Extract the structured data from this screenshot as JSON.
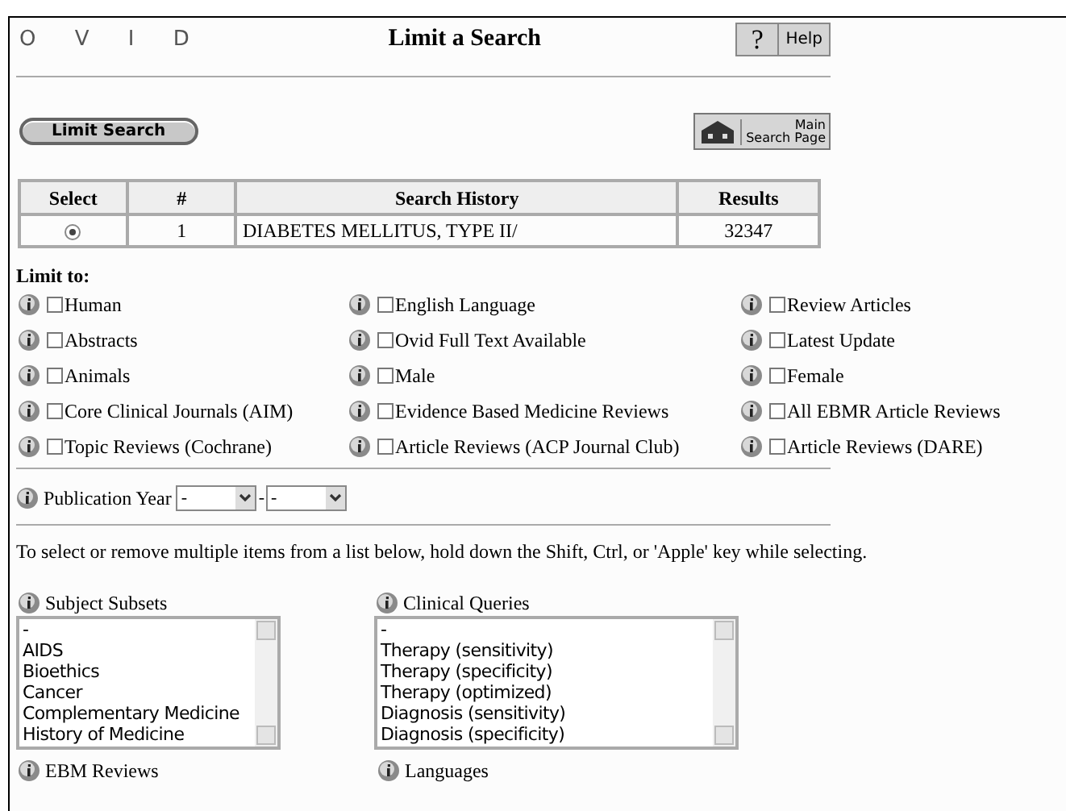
{
  "logo": "O V I D",
  "title": "Limit a Search",
  "help": {
    "icon_text": "?",
    "label": "Help"
  },
  "limit_button": "Limit Search",
  "main_button": {
    "line1": "Main",
    "line2": "Search Page"
  },
  "history": {
    "columns": [
      "Select",
      "#",
      "Search History",
      "Results"
    ],
    "rows": [
      {
        "selected": true,
        "number": "1",
        "search": "DIABETES MELLITUS, TYPE II/",
        "results": "32347"
      }
    ]
  },
  "limit_to": {
    "label": "Limit to:",
    "options": [
      {
        "label": "Human",
        "checked": false
      },
      {
        "label": "English Language",
        "checked": false
      },
      {
        "label": "Review Articles",
        "checked": false
      },
      {
        "label": "Abstracts",
        "checked": false
      },
      {
        "label": "Ovid Full Text Available",
        "checked": false
      },
      {
        "label": "Latest Update",
        "checked": false
      },
      {
        "label": "Animals",
        "checked": false
      },
      {
        "label": "Male",
        "checked": false
      },
      {
        "label": "Female",
        "checked": false
      },
      {
        "label": "Core Clinical Journals (AIM)",
        "checked": false
      },
      {
        "label": "Evidence Based Medicine Reviews",
        "checked": false
      },
      {
        "label": "All EBMR Article Reviews",
        "checked": false
      },
      {
        "label": "Topic Reviews (Cochrane)",
        "checked": false
      },
      {
        "label": "Article Reviews (ACP Journal Club)",
        "checked": false
      },
      {
        "label": "Article Reviews (DARE)",
        "checked": false
      }
    ]
  },
  "publication_year": {
    "label": "Publication Year",
    "from": "-",
    "separator": "-",
    "to": "-"
  },
  "instructions": "To select or remove multiple items from a list below, hold down the Shift, Ctrl, or 'Apple' key while selecting.",
  "lists": [
    {
      "label": "Subject Subsets",
      "items": [
        "-",
        "AIDS",
        "Bioethics",
        "Cancer",
        "Complementary Medicine",
        "History of Medicine"
      ]
    },
    {
      "label": "Clinical Queries",
      "items": [
        "-",
        "Therapy (sensitivity)",
        "Therapy (specificity)",
        "Therapy (optimized)",
        "Diagnosis (sensitivity)",
        "Diagnosis (specificity)"
      ]
    }
  ],
  "more_lists": [
    "EBM Reviews",
    "Languages"
  ]
}
